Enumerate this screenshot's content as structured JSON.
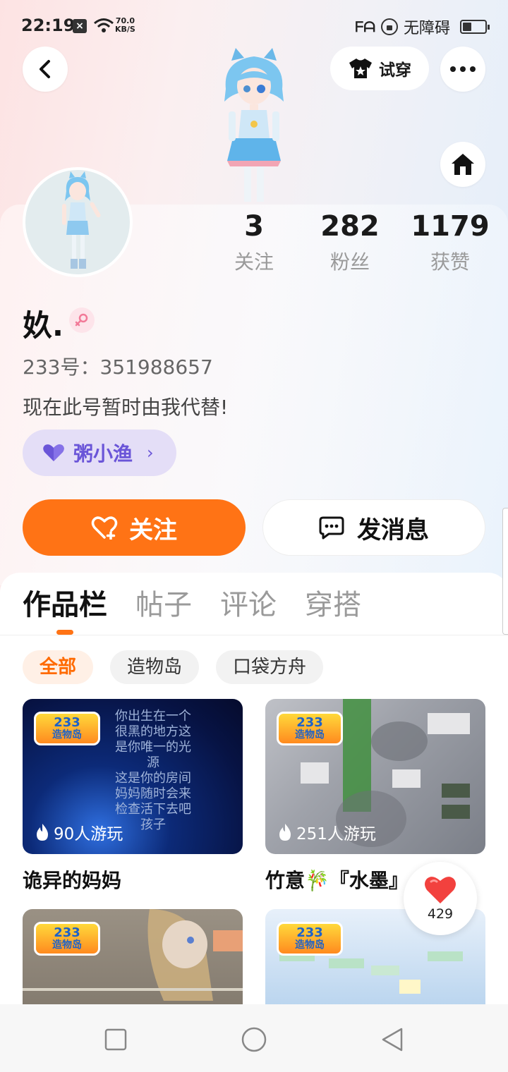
{
  "status_bar": {
    "time": "22:19",
    "speed_value": "70.0",
    "speed_unit": "KB/S",
    "carrier_badge": "ᖴᗩ",
    "accessibility_label": "无障碍"
  },
  "header": {
    "tryon_label": "试穿"
  },
  "profile": {
    "stats": [
      {
        "value": "3",
        "label": "关注"
      },
      {
        "value": "282",
        "label": "粉丝"
      },
      {
        "value": "1179",
        "label": "获赞"
      }
    ],
    "nickname": "奺.",
    "uid": "233号：351988657",
    "bio": "现在此号暂时由我代替!",
    "guardian_name": "粥小渔",
    "follow_label": "关注",
    "message_label": "发消息"
  },
  "tabs": [
    {
      "label": "作品栏",
      "active": true
    },
    {
      "label": "帖子",
      "active": false
    },
    {
      "label": "评论",
      "active": false
    },
    {
      "label": "穿搭",
      "active": false
    }
  ],
  "filters": [
    {
      "label": "全部",
      "active": true
    },
    {
      "label": "造物岛",
      "active": false
    },
    {
      "label": "口袋方舟",
      "active": false
    }
  ],
  "logo": {
    "top": "233",
    "bottom": "造物岛"
  },
  "games": [
    {
      "title": "诡异的妈妈",
      "plays": "90人游玩",
      "overlay_text": [
        "你出生在一个",
        "很黑的地方这",
        "是你唯一的光",
        "源",
        "这是你的房间",
        "妈妈随时会来",
        "检查活下去吧",
        "孩子"
      ]
    },
    {
      "title": "竹意🎋『水墨』",
      "plays": "251人游玩"
    },
    {
      "title": "",
      "plays": ""
    },
    {
      "title": "",
      "plays": ""
    }
  ],
  "like_fab": {
    "count": "429"
  },
  "colors": {
    "accent": "#ff7315",
    "guardian": "#6a55d8",
    "guardian_bg": "#e4def7"
  }
}
